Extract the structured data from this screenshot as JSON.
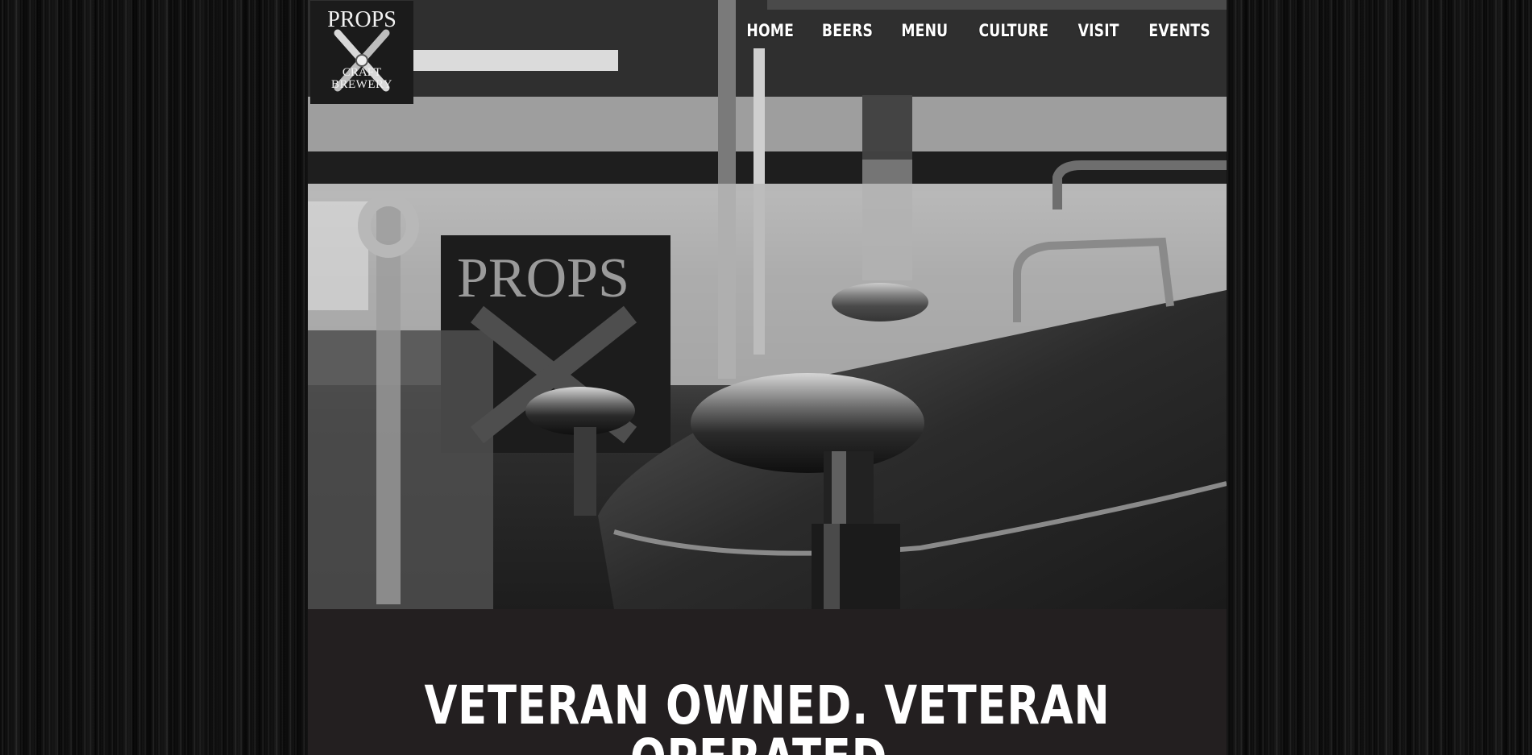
{
  "logo": {
    "line1": "PROPS",
    "line2": "CRAFT",
    "line3": "BREWERY"
  },
  "nav": {
    "items": [
      {
        "label": "HOME"
      },
      {
        "label": "BEERS"
      },
      {
        "label": "MENU"
      },
      {
        "label": "CULTURE"
      },
      {
        "label": "VISIT"
      },
      {
        "label": "EVENTS"
      }
    ]
  },
  "hero": {
    "sign_text": "PROPS"
  },
  "tagline": "VETERAN OWNED. VETERAN OPERATED.",
  "colors": {
    "page_background": "#050505",
    "content_background": "#231f20",
    "text": "#ffffff"
  }
}
